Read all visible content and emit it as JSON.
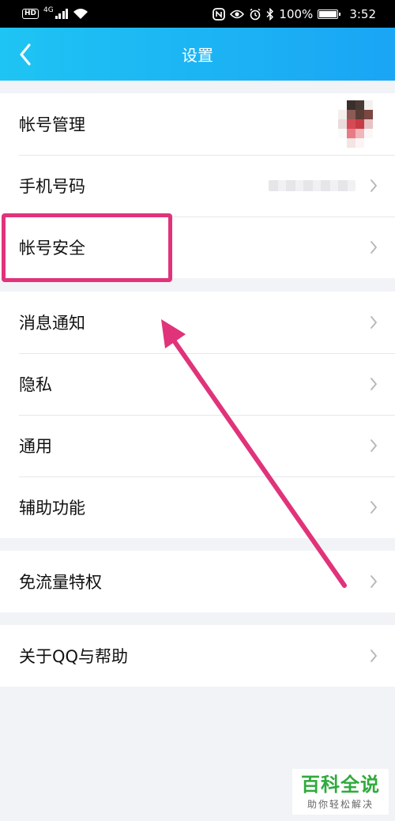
{
  "status_bar": {
    "hd": "HD",
    "network": "4G",
    "battery": "100%",
    "time": "3:52"
  },
  "header": {
    "title": "设置",
    "back_icon": "chevron-left-icon"
  },
  "groups": [
    {
      "items": [
        {
          "label": "帐号管理",
          "trailing": "avatar"
        },
        {
          "label": "手机号码",
          "trailing": "masked-phone"
        },
        {
          "label": "帐号安全",
          "trailing": "chevron"
        }
      ]
    },
    {
      "items": [
        {
          "label": "消息通知",
          "trailing": "chevron"
        },
        {
          "label": "隐私",
          "trailing": "chevron"
        },
        {
          "label": "通用",
          "trailing": "chevron"
        },
        {
          "label": "辅助功能",
          "trailing": "chevron"
        }
      ]
    },
    {
      "items": [
        {
          "label": "免流量特权",
          "trailing": "chevron"
        }
      ]
    },
    {
      "items": [
        {
          "label": "关于QQ与帮助",
          "trailing": "chevron"
        }
      ]
    }
  ],
  "annotation": {
    "color": "#e0337a",
    "highlighted_item": "帐号安全"
  },
  "watermark": {
    "logo_text": "百科全说",
    "tagline": "助你轻松解决"
  },
  "colors": {
    "header_start": "#1ec4f3",
    "header_end": "#1aa5f5",
    "background": "#f2f3f7",
    "chevron": "#b5b5ba"
  }
}
